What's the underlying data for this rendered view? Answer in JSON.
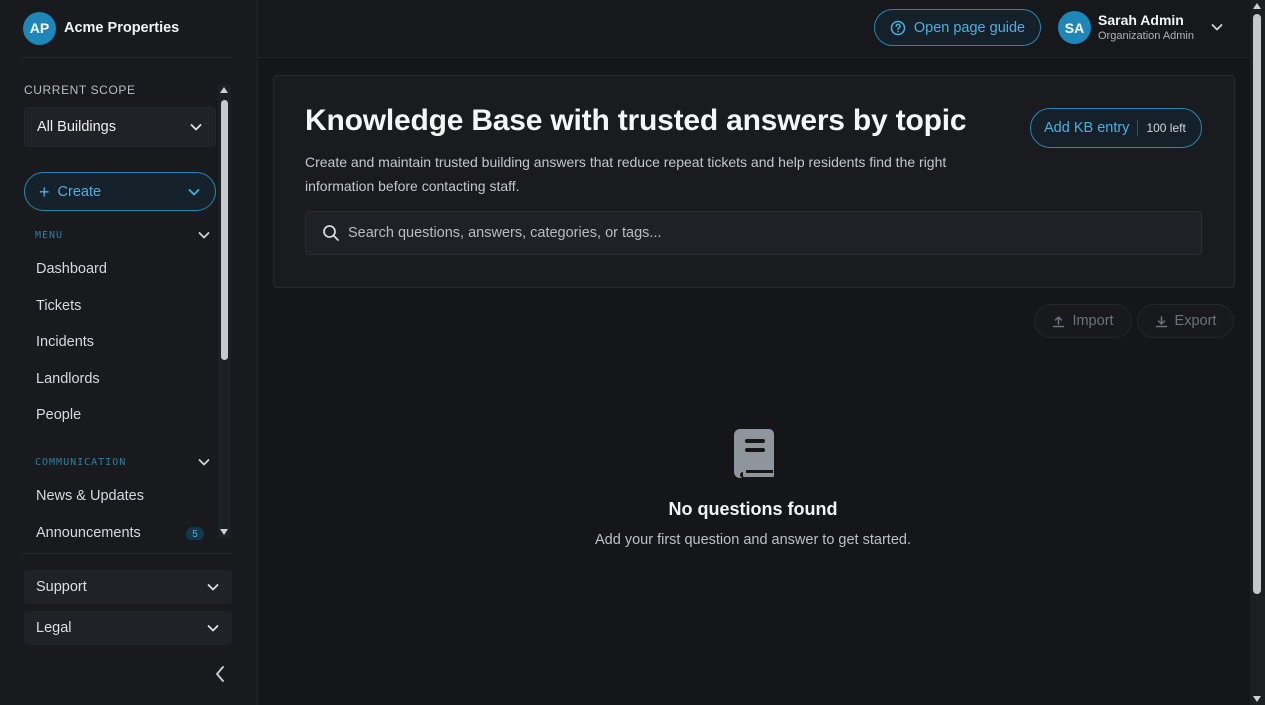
{
  "brand": {
    "initials": "AP",
    "name": "Acme Properties"
  },
  "sidebar": {
    "scope_label": "CURRENT SCOPE",
    "scope_value": "All Buildings",
    "create_label": "Create",
    "menu_heading": "MENU",
    "menu_items": [
      "Dashboard",
      "Tickets",
      "Incidents",
      "Landlords",
      "People"
    ],
    "communication_heading": "COMMUNICATION",
    "communication_items": [
      "News & Updates",
      "Announcements"
    ],
    "announcements_badge": "5",
    "footer_items": [
      "Support",
      "Legal"
    ]
  },
  "topbar": {
    "guide_label": "Open page guide",
    "user_initials": "SA",
    "user_name": "Sarah Admin",
    "user_role": "Organization Admin"
  },
  "hero": {
    "title": "Knowledge Base with trusted answers by topic",
    "description": "Create and maintain trusted building answers that reduce repeat tickets and help residents find the right information before contacting staff.",
    "add_label": "Add KB entry",
    "add_remaining": "100 left",
    "search_placeholder": "Search questions, answers, categories, or tags..."
  },
  "actions": {
    "import_label": "Import",
    "export_label": "Export"
  },
  "empty_state": {
    "title": "No questions found",
    "subtitle": "Add your first question and answer to get started."
  },
  "colors": {
    "accent": "#2a86b0",
    "accent_text": "#4db0de",
    "background": "#141619"
  }
}
